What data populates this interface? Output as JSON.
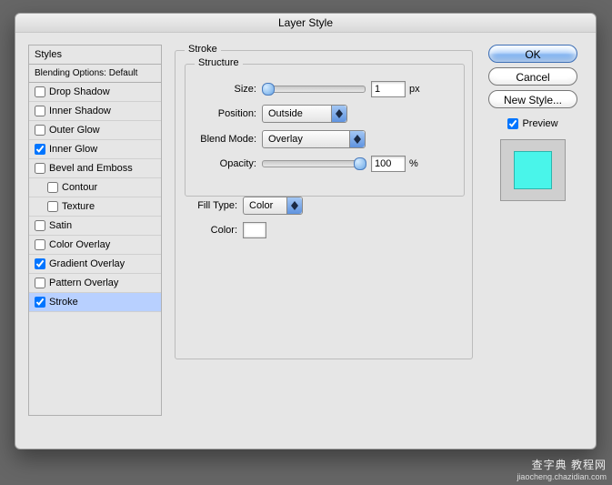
{
  "title": "Layer Style",
  "sidebar": {
    "header": "Styles",
    "blending": "Blending Options: Default",
    "items": [
      {
        "label": "Drop Shadow",
        "checked": false,
        "indent": false
      },
      {
        "label": "Inner Shadow",
        "checked": false,
        "indent": false
      },
      {
        "label": "Outer Glow",
        "checked": false,
        "indent": false
      },
      {
        "label": "Inner Glow",
        "checked": true,
        "indent": false
      },
      {
        "label": "Bevel and Emboss",
        "checked": false,
        "indent": false
      },
      {
        "label": "Contour",
        "checked": false,
        "indent": true
      },
      {
        "label": "Texture",
        "checked": false,
        "indent": true
      },
      {
        "label": "Satin",
        "checked": false,
        "indent": false
      },
      {
        "label": "Color Overlay",
        "checked": false,
        "indent": false
      },
      {
        "label": "Gradient Overlay",
        "checked": true,
        "indent": false
      },
      {
        "label": "Pattern Overlay",
        "checked": false,
        "indent": false
      },
      {
        "label": "Stroke",
        "checked": true,
        "active": true,
        "indent": false
      }
    ]
  },
  "stroke": {
    "group_label": "Stroke",
    "structure_label": "Structure",
    "size_label": "Size:",
    "size_value": "1",
    "size_unit": "px",
    "position_label": "Position:",
    "position_value": "Outside",
    "blend_label": "Blend Mode:",
    "blend_value": "Overlay",
    "opacity_label": "Opacity:",
    "opacity_value": "100",
    "opacity_unit": "%",
    "filltype_label": "Fill Type:",
    "filltype_value": "Color",
    "color_label": "Color:",
    "color_swatch": "#ffffff"
  },
  "buttons": {
    "ok": "OK",
    "cancel": "Cancel",
    "newstyle": "New Style..."
  },
  "preview": {
    "label": "Preview",
    "checked": true,
    "swatch": "#49f5ea"
  },
  "watermark": {
    "main": "查字典 教程网",
    "sub": "jiaocheng.chazidian.com"
  }
}
